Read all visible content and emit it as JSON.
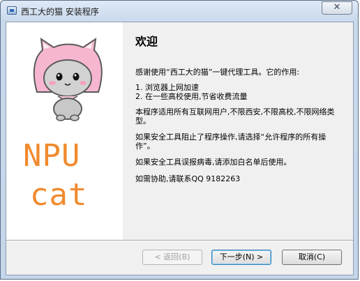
{
  "window": {
    "title": "西工大的猫 安装程序",
    "close_glyph": "✕"
  },
  "left_pane": {
    "logo_line1": "NPU",
    "logo_line2": "cat",
    "logo_color": "#f08a2e"
  },
  "main": {
    "heading": "欢迎",
    "intro": "感谢使用“西工大的猫”一键代理工具。它的作用:",
    "feature1": "1. 浏览器上网加速",
    "feature2": "2. 在一些高校使用,节省收费流量",
    "scope": "本程序适用所有互联网用户,不限西安,不限高校,不限网络类型。",
    "firewall": "如果安全工具阻止了程序操作,请选择“允许程序的所有操作”。",
    "antivirus": "如果安全工具误报病毒,请添加白名单后使用。",
    "contact": "如需协助,请联系QQ 9182263"
  },
  "buttons": {
    "back": "< 返回(B)",
    "next": "下一步(N) >",
    "cancel": "取消(C)"
  }
}
